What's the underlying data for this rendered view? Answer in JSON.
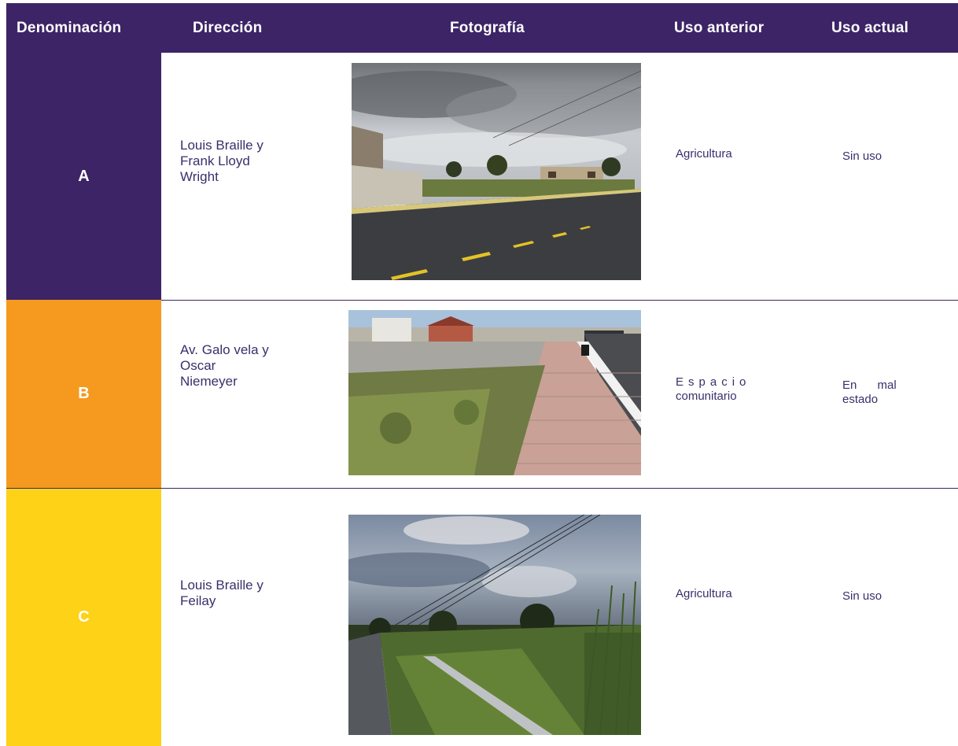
{
  "header": {
    "denominacion": "Denominación",
    "direccion": "Dirección",
    "fotografia": "Fotografía",
    "uso_anterior": "Uso anterior",
    "uso_actual": "Uso actual"
  },
  "rows": [
    {
      "denominacion": "A",
      "direccion_lines": [
        "Louis Braille y",
        "Frank Lloyd",
        "Wright"
      ],
      "uso_anterior_lines": [
        "Agricultura"
      ],
      "uso_actual_lines": [
        "Sin uso"
      ],
      "color": "#3d2466"
    },
    {
      "denominacion": "B",
      "direccion_lines": [
        "Av. Galo vela y",
        "Oscar",
        "Niemeyer"
      ],
      "uso_anterior_lines": [
        "Espacio",
        "comunitario"
      ],
      "uso_actual_lines": [
        "En mal",
        "estado"
      ],
      "color": "#f69a1f"
    },
    {
      "denominacion": "C",
      "direccion_lines": [
        "Louis Braille y",
        "Feilay"
      ],
      "uso_anterior_lines": [
        "Agricultura"
      ],
      "uso_actual_lines": [
        "Sin uso"
      ],
      "color": "#fdd217"
    }
  ],
  "colors": {
    "header_bg": "#3d2466",
    "text": "#3a2f6b"
  }
}
